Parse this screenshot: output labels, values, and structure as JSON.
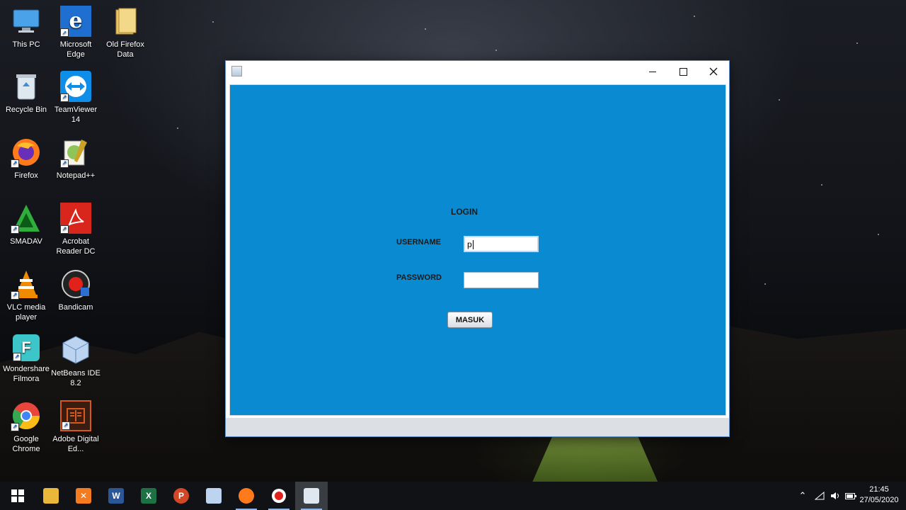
{
  "desktop": {
    "icons": [
      {
        "label": "This PC",
        "icon": "computer-icon",
        "color": "#3b8fd8"
      },
      {
        "label": "Microsoft Edge",
        "icon": "edge-icon",
        "color": "#1f6fd1"
      },
      {
        "label": "Old Firefox Data",
        "icon": "folder-icon",
        "color": "#e9c46a"
      },
      {
        "label": "Recycle Bin",
        "icon": "recycle-bin-icon",
        "color": "#b7c3cf"
      },
      {
        "label": "TeamViewer 14",
        "icon": "teamviewer-icon",
        "color": "#0e8ee9"
      },
      {
        "label": "Firefox",
        "icon": "firefox-icon",
        "color": "#ff7a1a"
      },
      {
        "label": "Notepad++",
        "icon": "notepadpp-icon",
        "color": "#8fc45a"
      },
      {
        "label": "SMADAV",
        "icon": "smadav-icon",
        "color": "#2fae3b"
      },
      {
        "label": "Acrobat Reader DC",
        "icon": "acrobat-icon",
        "color": "#d9261c"
      },
      {
        "label": "VLC media player",
        "icon": "vlc-icon",
        "color": "#f08a00"
      },
      {
        "label": "Bandicam",
        "icon": "bandicam-icon",
        "color": "#e0221a"
      },
      {
        "label": "Wondershare Filmora",
        "icon": "filmora-icon",
        "color": "#3cc6c9"
      },
      {
        "label": "NetBeans IDE 8.2",
        "icon": "netbeans-icon",
        "color": "#7fa7d8"
      },
      {
        "label": "Google Chrome",
        "icon": "chrome-icon",
        "color": "#e8453c"
      },
      {
        "label": "Adobe Digital Ed...",
        "icon": "digital-editions-icon",
        "color": "#d45a1f"
      }
    ]
  },
  "window": {
    "title": "",
    "login_title": "LOGIN",
    "username_label": "USERNAME",
    "username_value": "p",
    "password_label": "PASSWORD",
    "password_value": "",
    "submit_label": "MASUK",
    "accent": "#0a8ad1"
  },
  "taskbar": {
    "items": [
      {
        "name": "start-icon"
      },
      {
        "name": "file-explorer-icon"
      },
      {
        "name": "xampp-icon"
      },
      {
        "name": "word-icon"
      },
      {
        "name": "excel-icon"
      },
      {
        "name": "powerpoint-icon"
      },
      {
        "name": "netbeans-icon"
      },
      {
        "name": "firefox-icon"
      },
      {
        "name": "bandicam-icon"
      },
      {
        "name": "java-app-icon"
      }
    ],
    "time": "21:45",
    "date": "27/05/2020"
  }
}
